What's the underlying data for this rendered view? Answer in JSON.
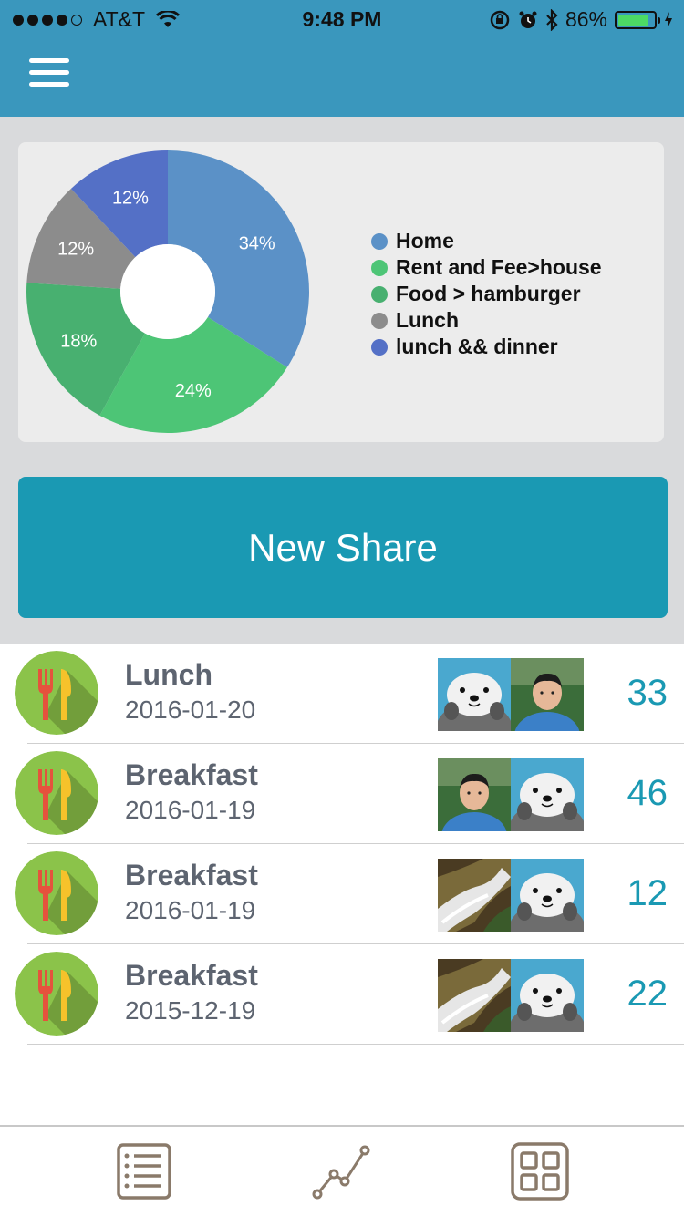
{
  "status_bar": {
    "carrier": "AT&T",
    "time": "9:48 PM",
    "battery": "86%",
    "battery_level": 0.86,
    "signal_bars": 4,
    "signal_max": 5
  },
  "header": {
    "menu_icon": "hamburger-menu-icon",
    "background": "#3a97bd"
  },
  "chart_data": {
    "type": "pie",
    "donut": true,
    "series": [
      {
        "name": "Home",
        "value": 34,
        "label": "34%",
        "color": "#5b91c7"
      },
      {
        "name": "Rent and Fee>house",
        "value": 24,
        "label": "24%",
        "color": "#4dc576"
      },
      {
        "name": "Food > hamburger",
        "value": 18,
        "label": "18%",
        "color": "#48b070"
      },
      {
        "name": "Lunch",
        "value": 12,
        "label": "12%",
        "color": "#8c8c8c"
      },
      {
        "name": "lunch && dinner",
        "value": 12,
        "label": "12%",
        "color": "#5470c6"
      }
    ],
    "legend_position": "right"
  },
  "new_share_label": "New Share",
  "new_share_color": "#1a99b3",
  "entries": [
    {
      "title": "Lunch",
      "date": "2016-01-20",
      "count": "33",
      "icon": "fork-knife-icon",
      "thumbs": [
        "otter",
        "person"
      ]
    },
    {
      "title": "Breakfast",
      "date": "2016-01-19",
      "count": "46",
      "icon": "fork-knife-icon",
      "thumbs": [
        "person",
        "otter"
      ]
    },
    {
      "title": "Breakfast",
      "date": "2016-01-19",
      "count": "12",
      "icon": "fork-knife-icon",
      "thumbs": [
        "waterfall",
        "otter"
      ]
    },
    {
      "title": "Breakfast",
      "date": "2015-12-19",
      "count": "22",
      "icon": "fork-knife-icon",
      "thumbs": [
        "waterfall",
        "otter"
      ]
    }
  ],
  "tab_bar": {
    "tabs": [
      {
        "icon": "list-icon"
      },
      {
        "icon": "line-chart-icon"
      },
      {
        "icon": "grid-icon"
      }
    ],
    "icon_color": "#8a7a6a"
  }
}
